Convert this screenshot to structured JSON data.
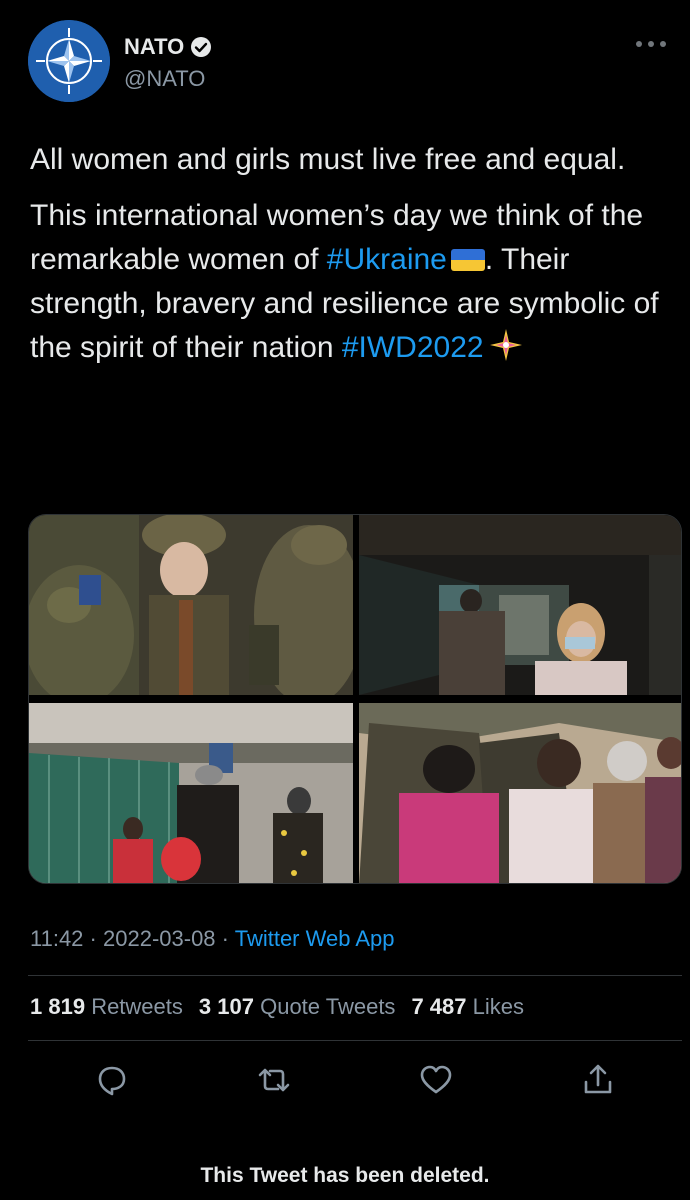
{
  "account": {
    "display_name": "NATO",
    "handle": "@NATO",
    "verified": true,
    "avatar_icon": "nato-compass-rose-logo",
    "more_icon": "more-horizontal-icon"
  },
  "tweet": {
    "paragraph1": "All women and girls must live free and equal.",
    "p2_part1": "This international women’s day we think of the remarkable women of ",
    "hashtag_ukraine": "#Ukraine",
    "p2_part2": ". Their strength, bravery and resilience are symbolic of the spirit of their nation ",
    "hashtag_iwd": "#IWD2022",
    "emoji_flag": "ukraine-flag-emoji",
    "emoji_sparkle": "compass-sparkle-emoji"
  },
  "media": {
    "photos": [
      "soldiers-photo",
      "corridor-photo",
      "refugees-border-photo",
      "camouflage-net-photo"
    ]
  },
  "meta": {
    "time": "11:42",
    "separator": "·",
    "date": "2022-03-08",
    "source": "Twitter Web App"
  },
  "stats": {
    "retweets_count": "1 819",
    "retweets_label": "Retweets",
    "quotes_count": "3 107",
    "quotes_label": "Quote Tweets",
    "likes_count": "7 487",
    "likes_label": "Likes"
  },
  "actions": [
    "reply-icon",
    "retweet-icon",
    "like-icon",
    "share-icon"
  ],
  "notice": "This Tweet has been deleted.",
  "colors": {
    "background": "#000000",
    "text": "#e7e9ea",
    "secondary": "#8b98a5",
    "link": "#1d9bf0",
    "avatar": "#1f5fae"
  }
}
